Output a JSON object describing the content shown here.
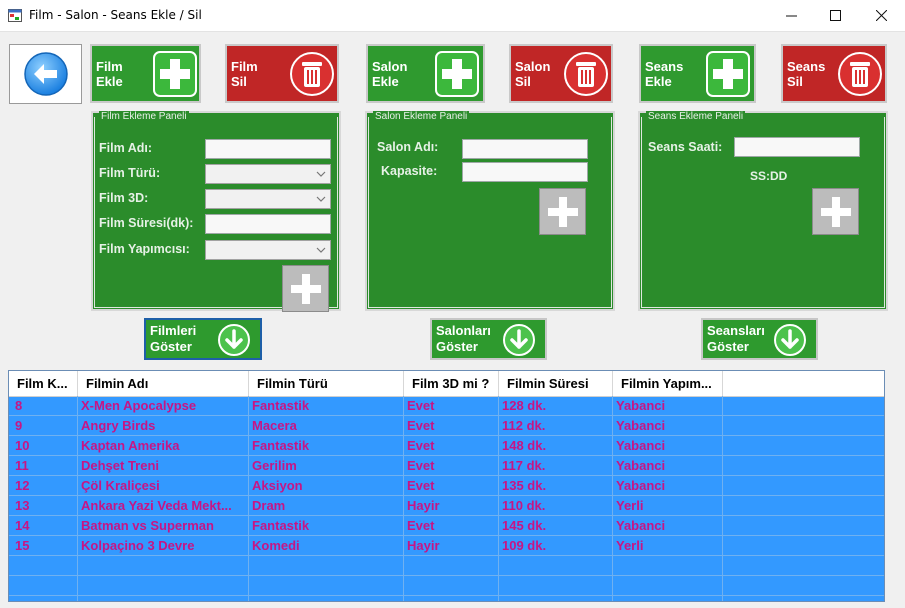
{
  "window": {
    "title": "Film - Salon - Seans Ekle / Sil"
  },
  "toolbar": {
    "film_ekle": "Film\nEkle",
    "film_sil": "Film\nSil",
    "salon_ekle": "Salon\nEkle",
    "salon_sil": "Salon\nSil",
    "seans_ekle": "Seans\nEkle",
    "seans_sil": "Seans\nSil"
  },
  "film_panel": {
    "legend": "Film Ekleme Paneli",
    "film_adi_label": "Film Adı:",
    "film_turu_label": "Film Türü:",
    "film_3d_label": "Film 3D:",
    "film_suresi_label": "Film Süresi(dk):",
    "film_yapimcisi_label": "Film Yapımcısı:",
    "film_adi_value": "",
    "film_suresi_value": "",
    "film_turu_value": "",
    "film_3d_value": "",
    "film_yapimcisi_value": ""
  },
  "salon_panel": {
    "legend": "Salon Ekleme Paneli",
    "salon_adi_label": "Salon Adı:",
    "kapasite_label": "Kapasite:",
    "salon_adi_value": "",
    "kapasite_value": ""
  },
  "seans_panel": {
    "legend": "Seans Ekleme Paneli",
    "seans_saati_label": "Seans Saati:",
    "seans_saati_value": "",
    "hint": "SS:DD"
  },
  "show_buttons": {
    "filmleri": "Filmleri\nGöster",
    "salonlari": "Salonları\nGöster",
    "seanslari": "Seansları\nGöster"
  },
  "grid": {
    "columns": [
      "Film K...",
      "Filmin Adı",
      "Filmin Türü",
      "Film 3D mi ?",
      "Filmin Süresi",
      "Filmin Yapım..."
    ],
    "rows": [
      [
        "8",
        "X-Men Apocalypse",
        "Fantastik",
        "Evet",
        "128 dk.",
        "Yabanci"
      ],
      [
        "9",
        "Angry Birds",
        "Macera",
        "Evet",
        "112 dk.",
        "Yabanci"
      ],
      [
        "10",
        "Kaptan Amerika",
        "Fantastik",
        "Evet",
        "148 dk.",
        "Yabanci"
      ],
      [
        "11",
        "Dehşet Treni",
        "Gerilim",
        "Evet",
        "117 dk.",
        "Yabanci"
      ],
      [
        "12",
        "Çöl Kraliçesi",
        "Aksiyon",
        "Evet",
        "135 dk.",
        "Yabanci"
      ],
      [
        "13",
        "Ankara Yazi Veda Mekt...",
        "Dram",
        "Hayir",
        "110 dk.",
        "Yerli"
      ],
      [
        "14",
        "Batman vs Superman",
        "Fantastik",
        "Evet",
        "145 dk.",
        "Yabanci"
      ],
      [
        "15",
        "Kolpaçino 3 Devre",
        "Komedi",
        "Hayir",
        "109 dk.",
        "Yerli"
      ]
    ]
  },
  "colors": {
    "panel_green": "#2b8c2b",
    "button_green": "#2f9a2f",
    "button_red": "#c02626",
    "grid_selection": "#3399ff",
    "grid_text": "#c71585"
  }
}
